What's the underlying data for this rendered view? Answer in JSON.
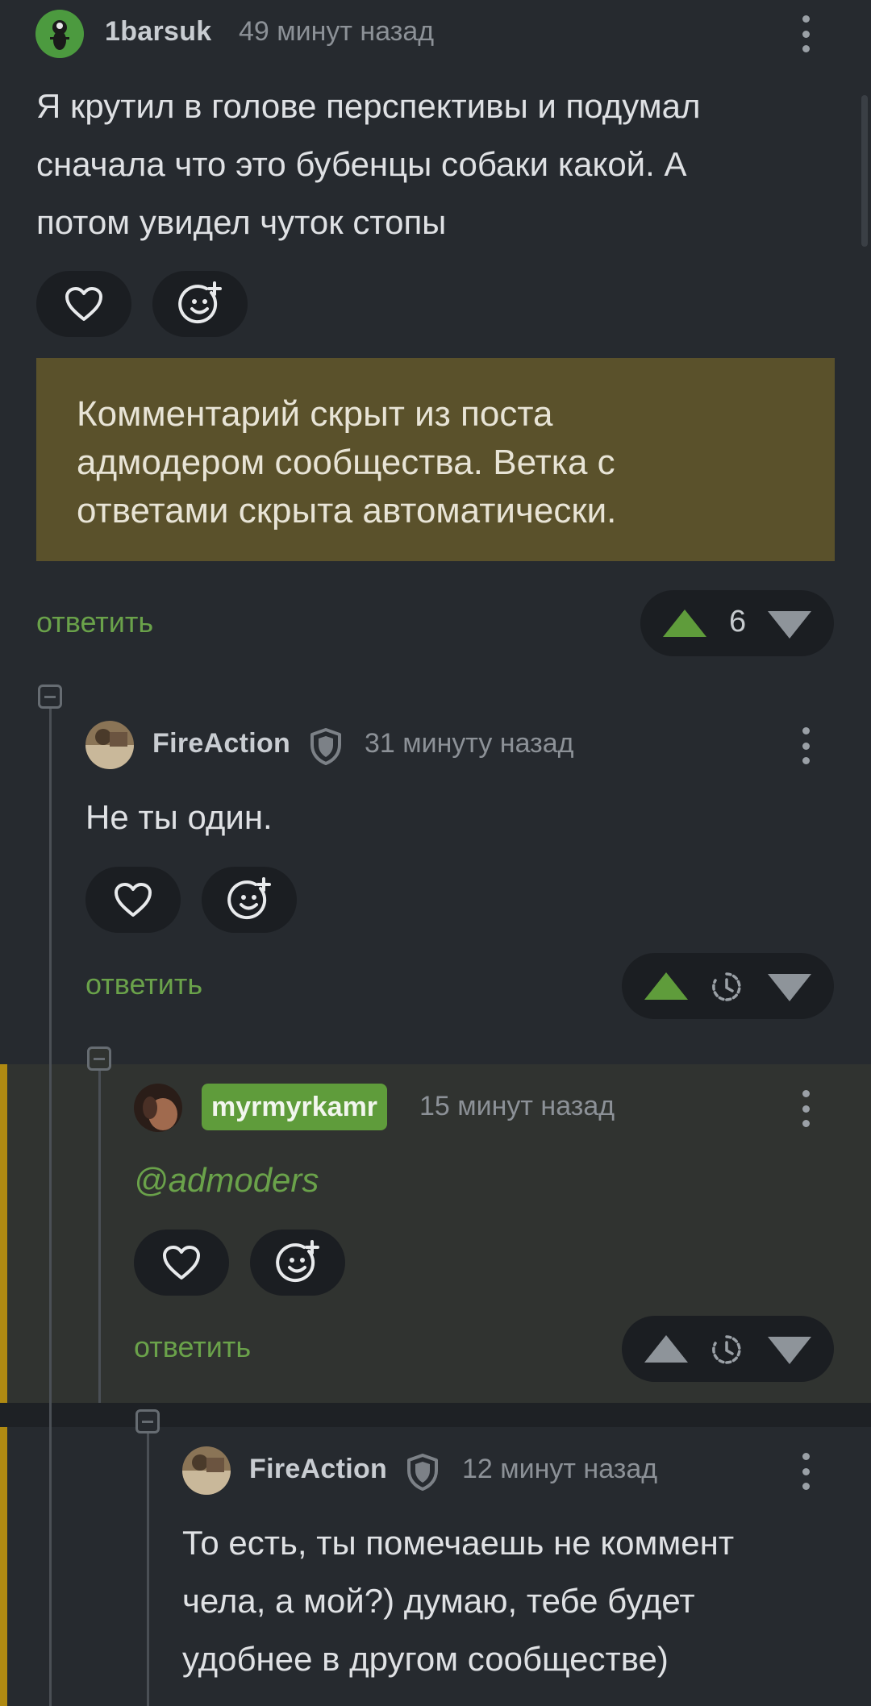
{
  "comments": [
    {
      "username": "1barsuk",
      "time": "49 минут назад",
      "lines": [
        "Я крутил в голове перспективы и подумал",
        "сначала что это бубенцы собаки какой. А",
        "потом увидел чуток стопы"
      ]
    },
    {
      "username": "FireAction",
      "time": "31 минуту назад",
      "lines": [
        "Не ты один."
      ]
    },
    {
      "username": "myrmyrkamr",
      "time": "15 минут назад",
      "lines": [
        "@admoders"
      ]
    },
    {
      "username": "FireAction",
      "time": "12 минут назад",
      "lines": [
        "То есть, ты помечаешь не коммент",
        "чела, а мой?) думаю, тебе будет",
        "удобнее в другом сообществе)"
      ]
    }
  ],
  "hidden_notice": {
    "lines": [
      "Комментарий скрыт из поста",
      "адмодером сообщества. Ветка с",
      "ответами скрыта автоматически."
    ]
  },
  "reply_label": "ответить",
  "rating": {
    "value": "6"
  },
  "icons": {
    "like": "heart-icon",
    "react": "emoji-add-icon",
    "menu": "more-vertical-icon",
    "upvote": "upvote-arrow-icon",
    "downvote": "downvote-arrow-icon",
    "pending": "clock-icon",
    "moderator": "shield-icon",
    "collapse": "collapse-thread-icon"
  },
  "colors": {
    "background": "#262a2f",
    "accent_green": "#5f9c3b",
    "notice_bg": "#5a512b",
    "highlight_stripe": "#b08a12"
  }
}
